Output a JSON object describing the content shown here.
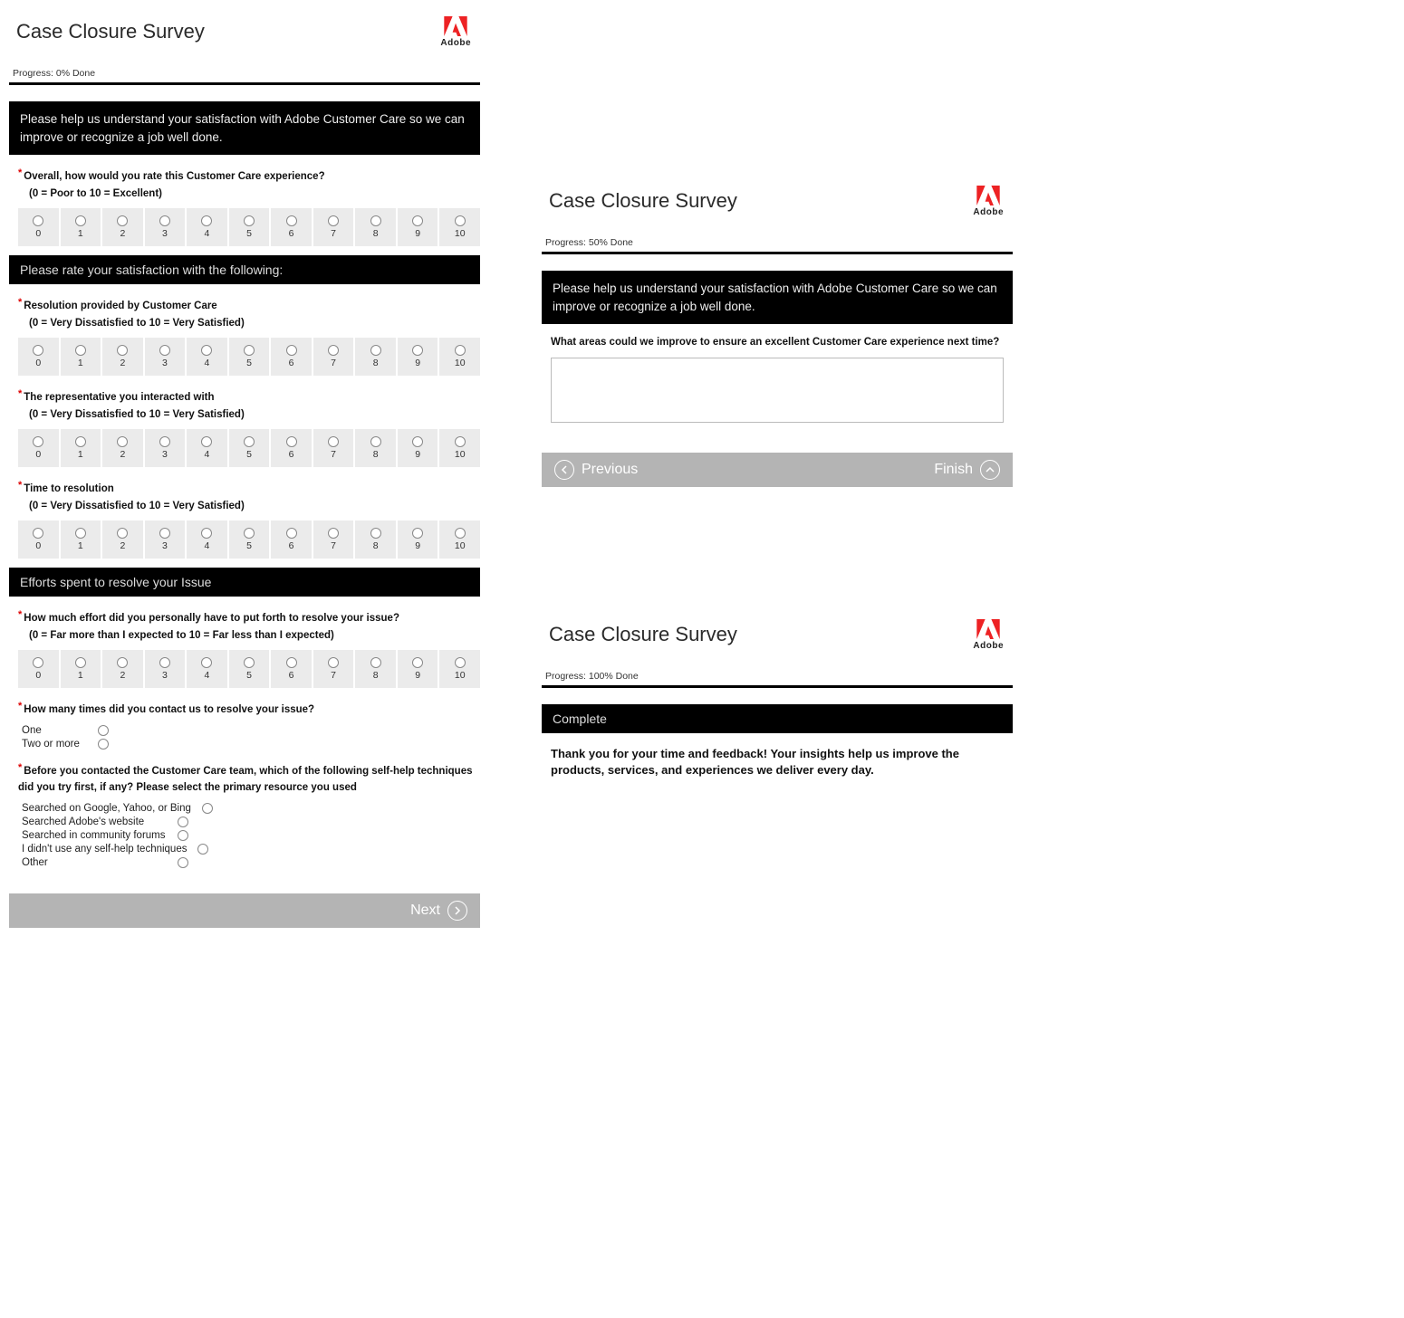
{
  "logo_label": "Adobe",
  "survey_title": "Case Closure Survey",
  "intro_text": "Please help us understand your satisfaction with Adobe Customer Care so we can improve or recognize a job well done.",
  "scale_values": [
    "0",
    "1",
    "2",
    "3",
    "4",
    "5",
    "6",
    "7",
    "8",
    "9",
    "10"
  ],
  "page1": {
    "progress": "Progress: 0% Done",
    "q_overall": {
      "text": "Overall, how would you rate this Customer Care experience?",
      "sub": "(0 = Poor to 10 = Excellent)"
    },
    "section_satisfaction": "Please rate your satisfaction with the following:",
    "q_resolution": {
      "text": "Resolution provided by Customer Care",
      "sub": "(0 = Very Dissatisfied to 10 = Very Satisfied)"
    },
    "q_representative": {
      "text": "The representative you interacted with",
      "sub": "(0 = Very Dissatisfied to 10 = Very Satisfied)"
    },
    "q_time": {
      "text": "Time to resolution",
      "sub": "(0 = Very Dissatisfied to 10 = Very Satisfied)"
    },
    "section_efforts": "Efforts spent to resolve your Issue",
    "q_effort": {
      "text": "How much effort did you personally have to put forth to resolve your issue?",
      "sub": "(0 = Far more than I expected to 10 = Far less than I expected)"
    },
    "q_contact_times": {
      "text": "How many times did you contact us to resolve your issue?",
      "options": [
        "One",
        "Two or more"
      ]
    },
    "q_selfhelp": {
      "text": "Before you contacted the Customer Care team, which of the following self-help techniques did you try first, if any? Please select the primary resource you used",
      "options": [
        "Searched on Google, Yahoo, or Bing",
        "Searched Adobe's website",
        "Searched in community forums",
        "I didn't use any self-help techniques",
        "Other"
      ]
    },
    "nav_next": "Next"
  },
  "page2": {
    "progress": "Progress: 50% Done",
    "q_improve": "What areas could we improve to ensure an excellent Customer Care experience next time?",
    "nav_prev": "Previous",
    "nav_finish": "Finish"
  },
  "page3": {
    "progress": "Progress: 100% Done",
    "section_complete": "Complete",
    "complete_msg": "Thank you for your time and feedback! Your insights help us improve the products, services, and experiences we deliver every day."
  }
}
